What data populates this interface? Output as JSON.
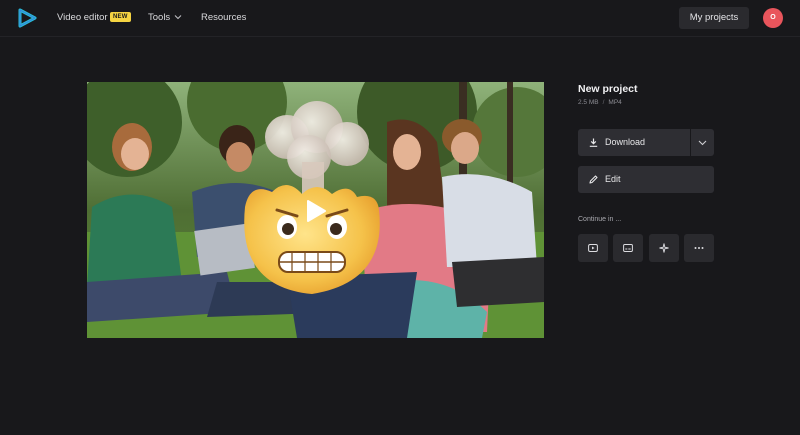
{
  "nav": {
    "video_editor": "Video editor",
    "badge": "NEW",
    "tools": "Tools",
    "resources": "Resources",
    "my_projects": "My projects",
    "avatar_initial": "O"
  },
  "project": {
    "title": "New project",
    "size": "2.5 MB",
    "format": "MP4"
  },
  "actions": {
    "download": "Download",
    "edit": "Edit",
    "continue_in": "Continue in ..."
  },
  "icons": {
    "logo": "play-triangle-logo-icon",
    "download": "download-icon",
    "edit": "pencil-icon",
    "dropdown": "chevron-down-icon",
    "continue": [
      "youtube-icon",
      "subtitles-icon",
      "sparkle-icon",
      "more-icon"
    ]
  },
  "colors": {
    "background": "#18181b",
    "button": "#2e2e33",
    "badge": "#f5d442",
    "avatar": "#e9555c",
    "logo_cyan": "#28c0d8"
  }
}
